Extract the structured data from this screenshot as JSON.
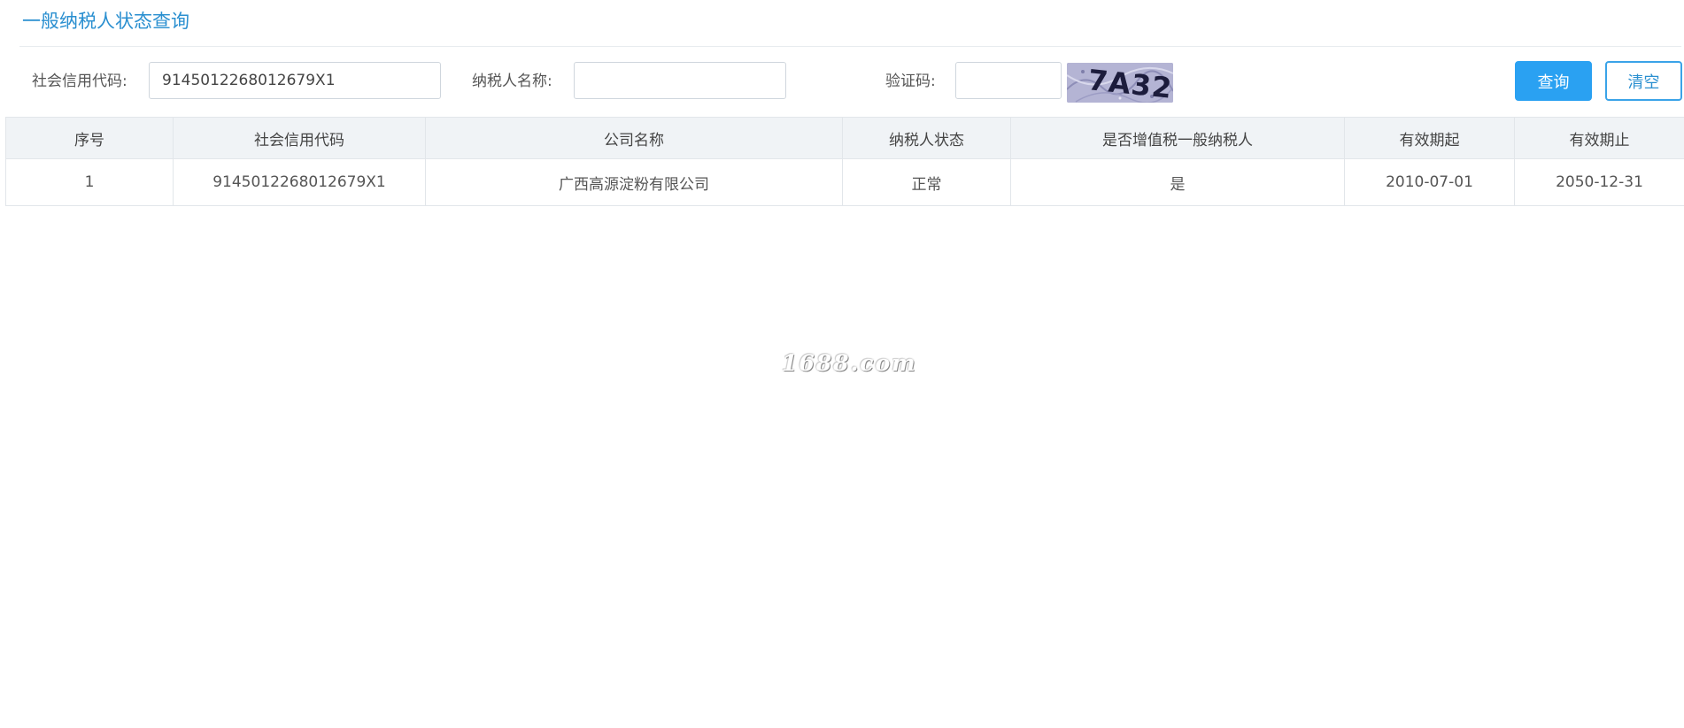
{
  "page": {
    "title": "一般纳税人状态查询"
  },
  "search": {
    "credit_code_label": "社会信用代码:",
    "credit_code_value": "9145012268012679X1",
    "taxpayer_name_label": "纳税人名称:",
    "taxpayer_name_value": "",
    "captcha_label": "验证码:",
    "captcha_value": "",
    "captcha_image_text": "7A32",
    "query_button": "查询",
    "clear_button": "清空"
  },
  "results": {
    "columns": [
      "序号",
      "社会信用代码",
      "公司名称",
      "纳税人状态",
      "是否增值税一般纳税人",
      "有效期起",
      "有效期止"
    ],
    "rows": [
      [
        "1",
        "9145012268012679X1",
        "广西高源淀粉有限公司",
        "正常",
        "是",
        "2010-07-01",
        "2050-12-31"
      ]
    ]
  },
  "watermark": "1688.com",
  "colors": {
    "accent": "#2a8fd0",
    "primary_button": "#2aa1f2",
    "header_bg": "#f0f3f6"
  }
}
